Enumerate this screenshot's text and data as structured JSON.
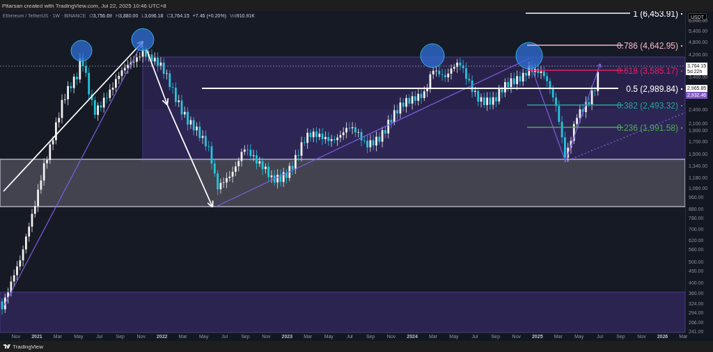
{
  "header": {
    "attribution": "Pitarsan created with TradingView.com, Jul 22, 2025 10:46 UTC+8"
  },
  "legend": {
    "symbol": "Ethereum / TetherUS · 1W · BINANCE",
    "values": [
      {
        "key": "O",
        "value": "3,756.69"
      },
      {
        "key": "H",
        "value": "3,880.00"
      },
      {
        "key": "L",
        "value": "3,696.18"
      },
      {
        "key": "C",
        "value": "3,764.15"
      }
    ],
    "change": "+7.46 (+0.20%)",
    "volume_key": "Vol",
    "volume": "910.91K"
  },
  "chart": {
    "fib_levels": [
      {
        "label": "1 (6,453.91)",
        "color": "#ffffff"
      },
      {
        "label": "0.786 (4,642.95)",
        "color": "#f4b6c2"
      },
      {
        "label": "0.618 (3,585.17)",
        "color": "#e91e63"
      },
      {
        "label": "0.5 (2,989.84)",
        "color": "#ffffff"
      },
      {
        "label": "0.382 (2,493.32)",
        "color": "#26a69a"
      },
      {
        "label": "0.236 (1,991.58)",
        "color": "#4caf50"
      }
    ],
    "price_axis": {
      "currency": "USDT",
      "ticks": [
        "6,000.00",
        "5,400.00",
        "4,800.00",
        "4,200.00",
        "3,400.00",
        "2,400.00",
        "2,100.00",
        "1,900.00",
        "1,700.00",
        "1,500.00",
        "1,340.00",
        "1,180.00",
        "1,060.00",
        "960.00",
        "880.00",
        "780.00",
        "700.00",
        "620.00",
        "560.00",
        "500.00",
        "450.00",
        "400.00",
        "360.00",
        "324.00",
        "294.00",
        "266.00",
        "241.00"
      ],
      "badges": [
        {
          "kind": "last",
          "text": "3,764.15",
          "subtext": "5d 22h"
        },
        {
          "kind": "line",
          "text": "2,965.85"
        },
        {
          "kind": "indicator",
          "text": "2,932.46"
        }
      ]
    },
    "time_axis": [
      {
        "label": "Nov",
        "kind": "month"
      },
      {
        "label": "2021",
        "kind": "year"
      },
      {
        "label": "Mar",
        "kind": "month"
      },
      {
        "label": "May",
        "kind": "month"
      },
      {
        "label": "Jul",
        "kind": "month"
      },
      {
        "label": "Sep",
        "kind": "month"
      },
      {
        "label": "Nov",
        "kind": "month"
      },
      {
        "label": "2022",
        "kind": "year"
      },
      {
        "label": "Mar",
        "kind": "month"
      },
      {
        "label": "May",
        "kind": "month"
      },
      {
        "label": "Jul",
        "kind": "month"
      },
      {
        "label": "Sep",
        "kind": "month"
      },
      {
        "label": "Nov",
        "kind": "month"
      },
      {
        "label": "2023",
        "kind": "year"
      },
      {
        "label": "Mar",
        "kind": "month"
      },
      {
        "label": "May",
        "kind": "month"
      },
      {
        "label": "Jul",
        "kind": "month"
      },
      {
        "label": "Sep",
        "kind": "month"
      },
      {
        "label": "Nov",
        "kind": "month"
      },
      {
        "label": "2024",
        "kind": "year"
      },
      {
        "label": "Mar",
        "kind": "month"
      },
      {
        "label": "May",
        "kind": "month"
      },
      {
        "label": "Jul",
        "kind": "month"
      },
      {
        "label": "Sep",
        "kind": "month"
      },
      {
        "label": "Nov",
        "kind": "month"
      },
      {
        "label": "2025",
        "kind": "year"
      },
      {
        "label": "Mar",
        "kind": "month"
      },
      {
        "label": "May",
        "kind": "month"
      },
      {
        "label": "Jul",
        "kind": "month"
      },
      {
        "label": "Sep",
        "kind": "month"
      },
      {
        "label": "Nov",
        "kind": "month"
      },
      {
        "label": "2026",
        "kind": "year"
      },
      {
        "label": "Mar",
        "kind": "month"
      }
    ]
  },
  "footer": {
    "brand": "TradingView"
  }
}
